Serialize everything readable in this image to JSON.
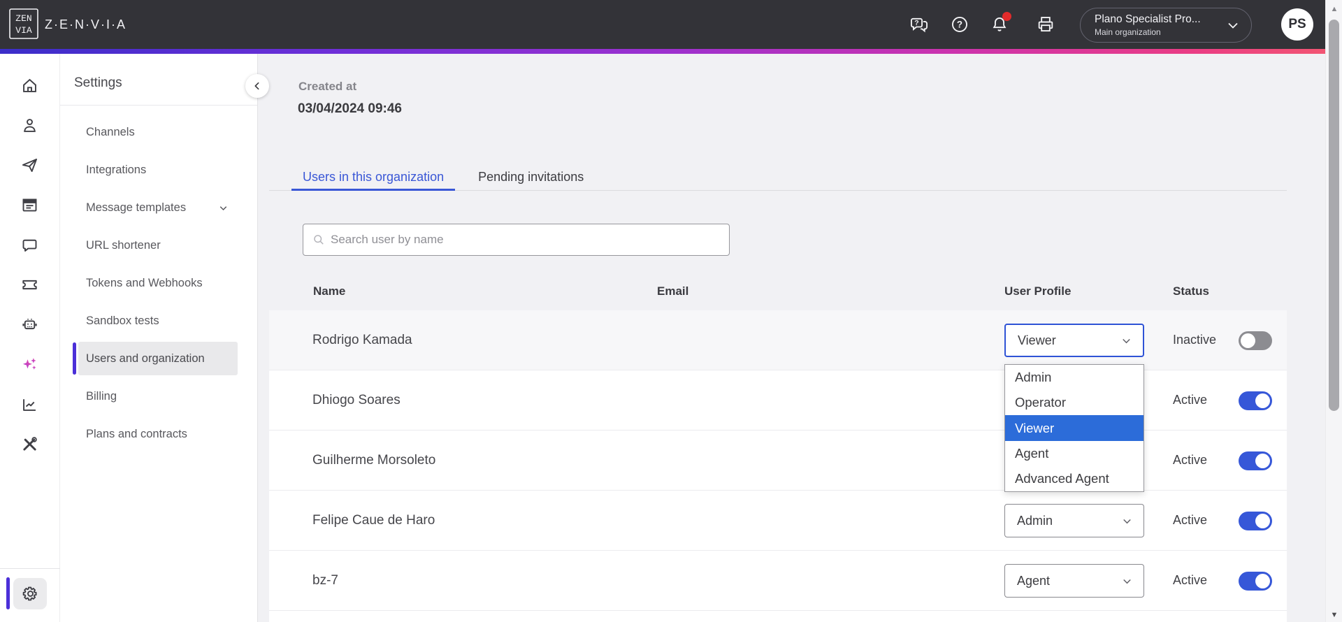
{
  "topbar": {
    "brand": "Z·E·N·V·I·A",
    "org": {
      "name": "Plano Specialist Pro...",
      "type": "Main organization"
    },
    "avatar": "PS"
  },
  "sidebar": {
    "title": "Settings",
    "items": [
      {
        "label": "Channels",
        "selected": false,
        "chevron": false
      },
      {
        "label": "Integrations",
        "selected": false,
        "chevron": false
      },
      {
        "label": "Message templates",
        "selected": false,
        "chevron": true
      },
      {
        "label": "URL shortener",
        "selected": false,
        "chevron": false
      },
      {
        "label": "Tokens and Webhooks",
        "selected": false,
        "chevron": false
      },
      {
        "label": "Sandbox tests",
        "selected": false,
        "chevron": false
      },
      {
        "label": "Users and organization",
        "selected": true,
        "chevron": false
      },
      {
        "label": "Billing",
        "selected": false,
        "chevron": false
      },
      {
        "label": "Plans and contracts",
        "selected": false,
        "chevron": false
      }
    ]
  },
  "main": {
    "created_label": "Created at",
    "created_value": "03/04/2024 09:46",
    "tabs": [
      {
        "label": "Users in this organization",
        "active": true
      },
      {
        "label": "Pending invitations",
        "active": false
      }
    ],
    "search": {
      "placeholder": "Search user by name"
    },
    "table": {
      "columns": [
        "Name",
        "Email",
        "User Profile",
        "Status"
      ],
      "rows": [
        {
          "name": "Rodrigo Kamada",
          "email": "",
          "profile": "Viewer",
          "status": "Inactive",
          "active": false,
          "focused": true
        },
        {
          "name": "Dhiogo Soares",
          "email": "",
          "profile": "",
          "status": "Active",
          "active": true,
          "focused": false
        },
        {
          "name": "Guilherme Morsoleto",
          "email": "",
          "profile": "",
          "status": "Active",
          "active": true,
          "focused": false
        },
        {
          "name": "Felipe Caue de Haro",
          "email": "",
          "profile": "Admin",
          "status": "Active",
          "active": true,
          "focused": false
        },
        {
          "name": "bz-7",
          "email": "",
          "profile": "Agent",
          "status": "Active",
          "active": true,
          "focused": false
        }
      ]
    },
    "profile_menu": {
      "options": [
        "Admin",
        "Operator",
        "Viewer",
        "Agent",
        "Advanced Agent"
      ],
      "selected": "Viewer"
    }
  },
  "colors": {
    "accent_blue": "#3a57d6",
    "menu_highlight": "#2c6cd9",
    "notification_red": "#e22b2b",
    "selected_indicator": "#4b2fd8",
    "topbar_bg": "#333338",
    "gradient": [
      "#3b2ec9",
      "#6e2fd8",
      "#9c31cf",
      "#cc33ad",
      "#ea3d84",
      "#f25573"
    ]
  }
}
